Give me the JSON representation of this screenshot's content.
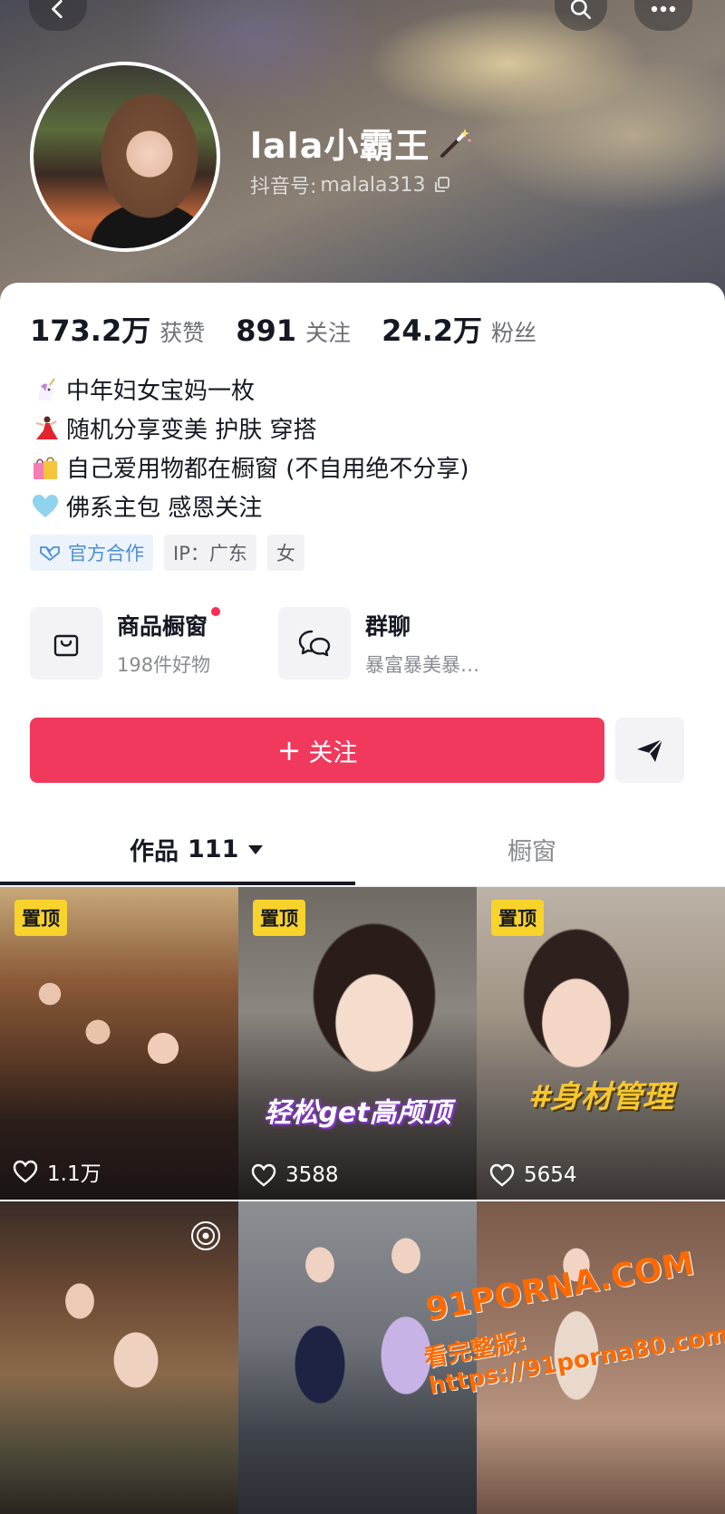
{
  "profile": {
    "name": "lala小霸王",
    "uid_label": "抖音号:",
    "uid_value": "malala313"
  },
  "stats": [
    {
      "value": "173.2万",
      "label": "获赞"
    },
    {
      "value": "891",
      "label": "关注"
    },
    {
      "value": "24.2万",
      "label": "粉丝"
    }
  ],
  "bio": [
    {
      "emoji": "unicorn-emoji",
      "text": "中年妇女宝妈一枚"
    },
    {
      "emoji": "dancer-emoji",
      "text": "随机分享变美 护肤 穿搭"
    },
    {
      "emoji": "shopping-bags-emoji",
      "text": "自己爱用物都在橱窗 (不自用绝不分享)"
    },
    {
      "emoji": "blue-heart-emoji",
      "text": "佛系主包 感恩关注"
    }
  ],
  "tags": {
    "official": "官方合作",
    "ip": "IP：广东",
    "gender": "女"
  },
  "features": {
    "shop_title": "商品橱窗",
    "shop_sub": "198件好物",
    "group_title": "群聊",
    "group_sub": "暴富暴美暴…"
  },
  "actions": {
    "follow_plus": "+",
    "follow_label": "关注"
  },
  "tabs": {
    "works_label": "作品",
    "works_count": "111",
    "shop_label": "橱窗"
  },
  "grid": [
    {
      "pinned": "置顶",
      "likes": "1.1万",
      "caption": ""
    },
    {
      "pinned": "置顶",
      "likes": "3588",
      "caption": "轻松get高颅顶"
    },
    {
      "pinned": "置顶",
      "likes": "5654",
      "caption": "#身材管理"
    },
    {
      "pinned": "",
      "likes": "",
      "caption": ""
    },
    {
      "pinned": "",
      "likes": "",
      "caption": ""
    },
    {
      "pinned": "",
      "likes": "",
      "caption": ""
    }
  ],
  "watermark": {
    "line1": "91PORNA.COM",
    "line2": "看完整版: https://91porna80.com"
  },
  "colors": {
    "primary": "#fe2c55",
    "follow_button": "#f0395c",
    "pin_badge": "#f7d32b",
    "text": "#161823",
    "muted": "#8a8b91"
  }
}
